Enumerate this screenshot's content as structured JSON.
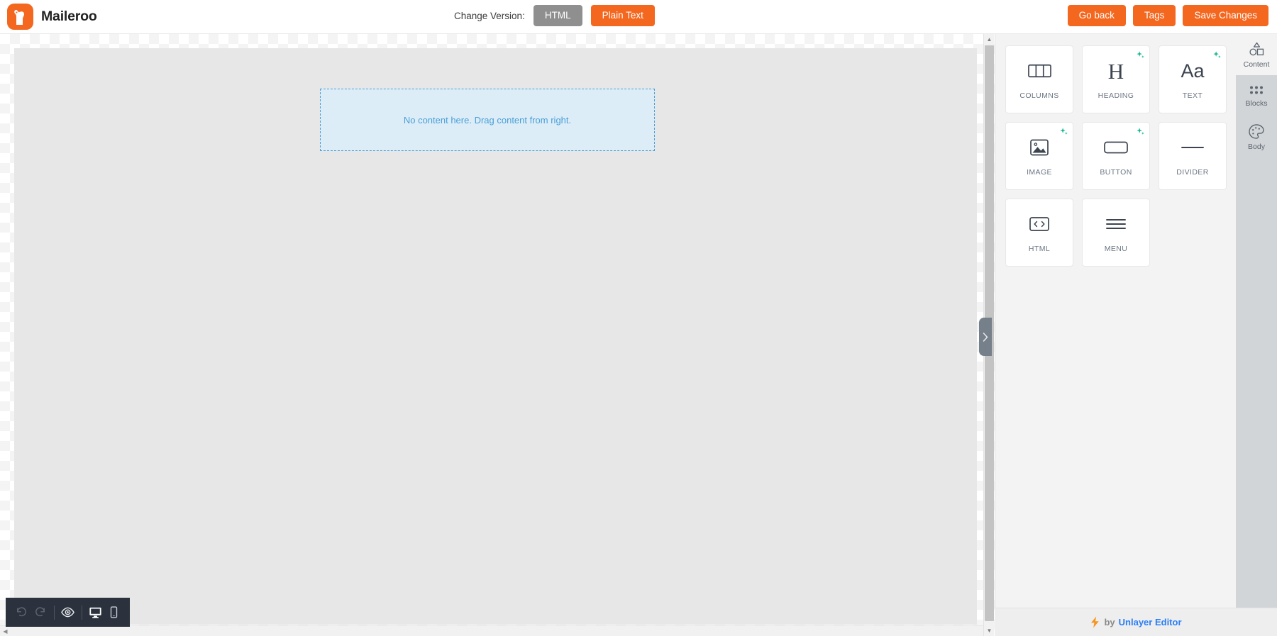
{
  "app": {
    "brand_name": "Maileroo",
    "logo_icon": "maileroo-kangaroo-logo"
  },
  "topbar": {
    "version_label": "Change Version:",
    "version_options": [
      {
        "label": "HTML",
        "state": "inactive"
      },
      {
        "label": "Plain Text",
        "state": "active"
      }
    ],
    "html_label": "HTML",
    "plain_text_label": "Plain Text",
    "go_back_label": "Go back",
    "tags_label": "Tags",
    "save_changes_label": "Save Changes",
    "accent_color": "#f4671f",
    "inactive_color": "#8f8f8f"
  },
  "canvas": {
    "dropzone_text": "No content here. Drag content from right.",
    "dropzone_border_color": "#4a9fd8",
    "dropzone_fill_color": "#dcedf7",
    "body_color": "#e7e7e7"
  },
  "editor_toolbar": {
    "buttons": [
      {
        "name": "undo",
        "icon": "undo-icon",
        "state": "disabled"
      },
      {
        "name": "redo",
        "icon": "redo-icon",
        "state": "disabled"
      },
      {
        "name": "preview",
        "icon": "eye-icon",
        "state": "enabled"
      },
      {
        "name": "desktop",
        "icon": "desktop-icon",
        "state": "active"
      },
      {
        "name": "mobile",
        "icon": "mobile-icon",
        "state": "enabled"
      }
    ],
    "background_color": "#2b323d"
  },
  "panel": {
    "collapse_handle_icon": "chevron-right-icon",
    "tiles": [
      {
        "label": "COLUMNS",
        "icon": "columns-icon",
        "ai_badge": false
      },
      {
        "label": "HEADING",
        "icon": "heading-icon",
        "ai_badge": true
      },
      {
        "label": "TEXT",
        "icon": "text-icon",
        "ai_badge": true
      },
      {
        "label": "IMAGE",
        "icon": "image-icon",
        "ai_badge": true
      },
      {
        "label": "BUTTON",
        "icon": "button-icon",
        "ai_badge": true
      },
      {
        "label": "DIVIDER",
        "icon": "divider-icon",
        "ai_badge": false
      },
      {
        "label": "HTML",
        "icon": "code-icon",
        "ai_badge": false
      },
      {
        "label": "MENU",
        "icon": "menu-icon",
        "ai_badge": false
      }
    ],
    "ai_badge_color": "#14b892"
  },
  "rail": {
    "tabs": [
      {
        "label": "Content",
        "icon": "shapes-icon",
        "active": true
      },
      {
        "label": "Blocks",
        "icon": "dots-grid-icon",
        "active": false
      },
      {
        "label": "Body",
        "icon": "palette-icon",
        "active": false
      }
    ]
  },
  "footer": {
    "bolt_icon": "lightning-bolt-icon",
    "by_text": "by",
    "link_text": "Unlayer Editor",
    "link_color": "#2b7ef5",
    "bolt_color": "#f7941e"
  }
}
